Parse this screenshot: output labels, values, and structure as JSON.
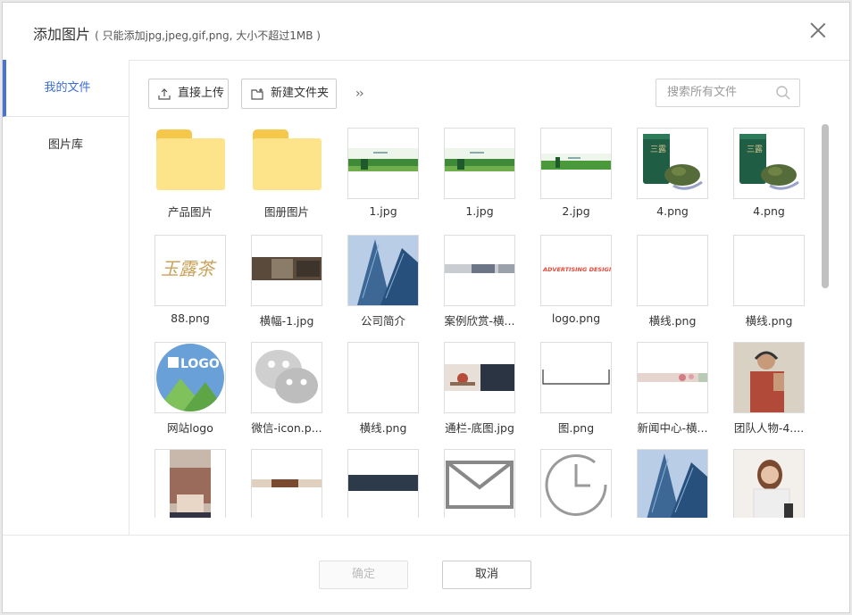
{
  "dialog": {
    "title": "添加图片",
    "subtitle": "( 只能添加jpg,jpeg,gif,png, 大小不超过1MB )"
  },
  "sidebar": {
    "items": [
      {
        "label": "我的文件",
        "active": true
      },
      {
        "label": "图片库",
        "active": false
      }
    ]
  },
  "toolbar": {
    "upload_label": "直接上传",
    "new_folder_label": "新建文件夹",
    "more_symbol": "»",
    "search_placeholder": "搜索所有文件"
  },
  "files": [
    {
      "name": "产品图片",
      "kind": "folder"
    },
    {
      "name": "图册图片",
      "kind": "folder"
    },
    {
      "name": "1.jpg",
      "kind": "banner-green"
    },
    {
      "name": "1.jpg",
      "kind": "banner-green"
    },
    {
      "name": "2.jpg",
      "kind": "banner-green-thin"
    },
    {
      "name": "4.png",
      "kind": "tea-can"
    },
    {
      "name": "4.png",
      "kind": "tea-can"
    },
    {
      "name": "88.png",
      "kind": "calligraphy"
    },
    {
      "name": "横幅-1.jpg",
      "kind": "strip-dark"
    },
    {
      "name": "公司简介",
      "kind": "building"
    },
    {
      "name": "案例欣赏-横...",
      "kind": "strip-office"
    },
    {
      "name": "logo.png",
      "kind": "advertising"
    },
    {
      "name": "横线.png",
      "kind": "blank"
    },
    {
      "name": "横线.png",
      "kind": "blank"
    },
    {
      "name": "网站logo",
      "kind": "logo-circle"
    },
    {
      "name": "微信-icon.p...",
      "kind": "wechat"
    },
    {
      "name": "横线.png",
      "kind": "blank"
    },
    {
      "name": "通栏-底图.jpg",
      "kind": "strip-desk"
    },
    {
      "name": "图.png",
      "kind": "bracket"
    },
    {
      "name": "新闻中心-横...",
      "kind": "strip-flowers"
    },
    {
      "name": "团队人物-4....",
      "kind": "person-headphones"
    },
    {
      "name": "",
      "kind": "hands"
    },
    {
      "name": "",
      "kind": "strip-thin"
    },
    {
      "name": "",
      "kind": "strip-navy"
    },
    {
      "name": "",
      "kind": "envelope"
    },
    {
      "name": "",
      "kind": "clock"
    },
    {
      "name": "",
      "kind": "building"
    },
    {
      "name": "",
      "kind": "woman"
    }
  ],
  "advertising_text": "ADVERTISING DESIGN",
  "logo_text": "LOGO",
  "calligraphy_text": "玉露茶",
  "footer": {
    "confirm_label": "确定",
    "cancel_label": "取消"
  },
  "colors": {
    "accent": "#3a6ed5",
    "folder_front": "#fde38a",
    "folder_tab": "#f5c74a"
  }
}
